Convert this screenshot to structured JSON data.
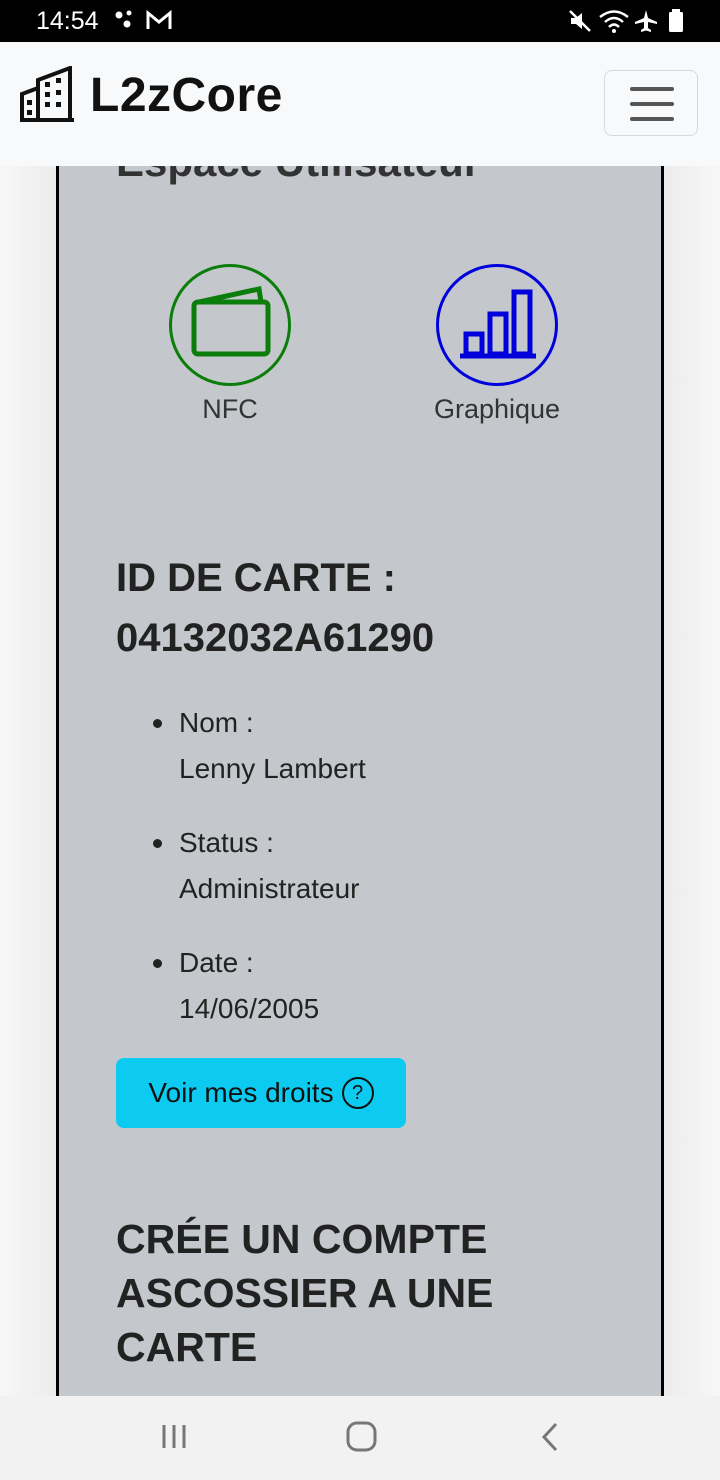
{
  "status_bar": {
    "time": "14:54",
    "icons": [
      "dots-icon",
      "gmail-icon",
      "mute-icon",
      "wifi-icon",
      "airplane-icon",
      "battery-icon"
    ]
  },
  "navbar": {
    "brand": "L2zCore",
    "brand_icon": "building-icon",
    "menu_icon": "hamburger-icon"
  },
  "section": {
    "title": "Espace Utilisateur"
  },
  "tiles": [
    {
      "label": "NFC",
      "icon": "wallet-icon",
      "color": "#0a7d0a"
    },
    {
      "label": "Graphique",
      "icon": "bar-chart-icon",
      "color": "#0000dd"
    }
  ],
  "card": {
    "id_label": "ID DE CARTE :",
    "id_value": "04132032A61290",
    "details": [
      {
        "label": "Nom :",
        "value": "Lenny Lambert"
      },
      {
        "label": "Status :",
        "value": "Administrateur"
      },
      {
        "label": "Date :",
        "value": "14/06/2005"
      }
    ],
    "rights_button": "Voir mes droits",
    "rights_button_icon": "?"
  },
  "create_account": {
    "title": "CRÉE UN COMPTE ASCOSSIER A UNE CARTE"
  },
  "colors": {
    "card_bg": "#c4c7cb",
    "button_bg": "#0dcaf0"
  }
}
